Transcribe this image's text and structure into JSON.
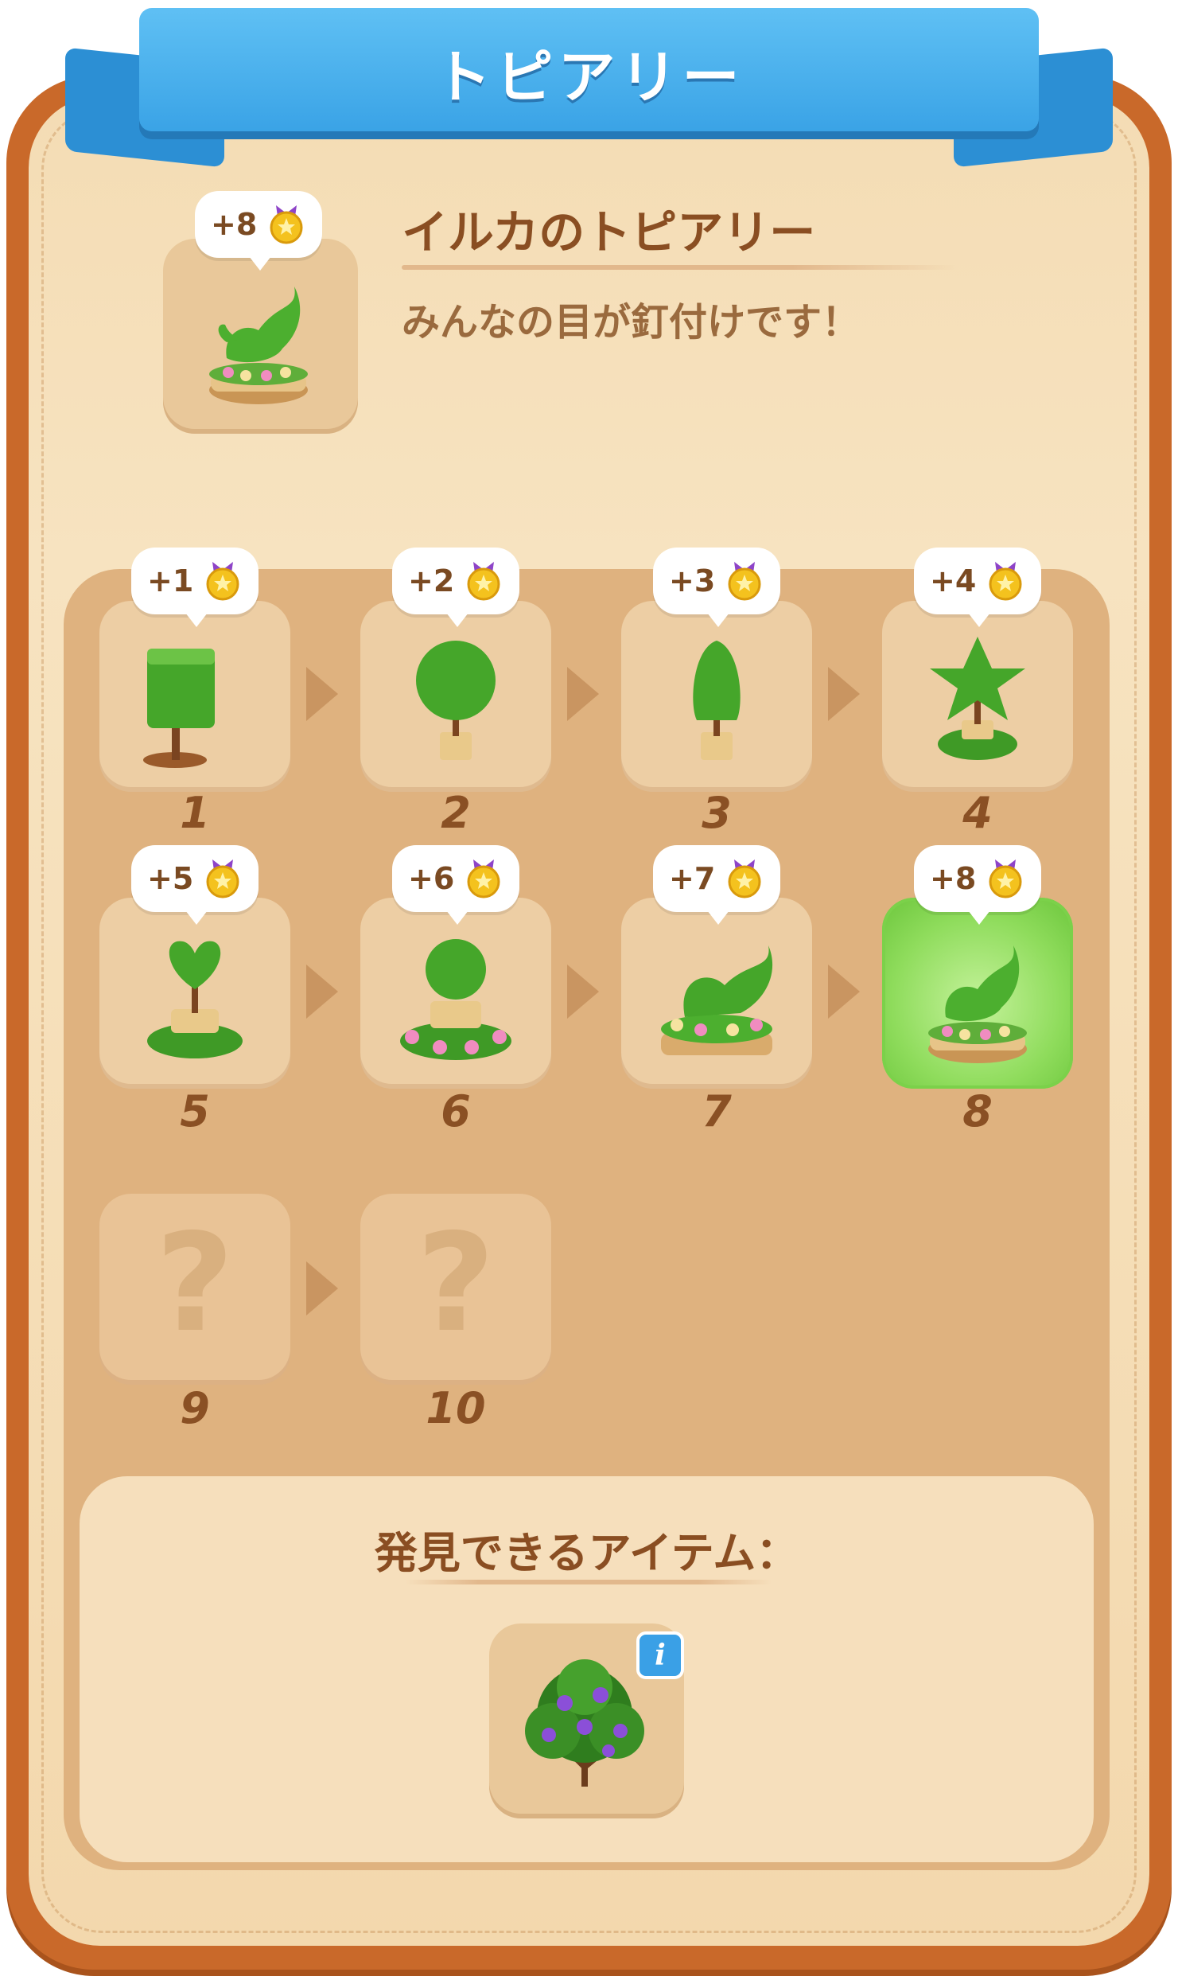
{
  "header": {
    "title": "トピアリー"
  },
  "featured": {
    "bonus": "+8",
    "name": "イルカのトピアリー",
    "description": "みんなの目が釘付けです！"
  },
  "stages": [
    {
      "number": "1",
      "bonus": "+1",
      "state": "unlocked"
    },
    {
      "number": "2",
      "bonus": "+2",
      "state": "unlocked"
    },
    {
      "number": "3",
      "bonus": "+3",
      "state": "unlocked"
    },
    {
      "number": "4",
      "bonus": "+4",
      "state": "unlocked"
    },
    {
      "number": "5",
      "bonus": "+5",
      "state": "unlocked"
    },
    {
      "number": "6",
      "bonus": "+6",
      "state": "unlocked"
    },
    {
      "number": "7",
      "bonus": "+7",
      "state": "unlocked"
    },
    {
      "number": "8",
      "bonus": "+8",
      "state": "current"
    },
    {
      "number": "9",
      "placeholder": "?",
      "state": "locked"
    },
    {
      "number": "10",
      "placeholder": "?",
      "state": "locked"
    }
  ],
  "discoverable": {
    "title": "発見できるアイテム：",
    "item_icon": "flowering-bush-icon",
    "info_icon": "info-icon"
  },
  "colors": {
    "banner": "#3aa3e6",
    "frame": "#c9692a",
    "active_cell": "#8fdc5c",
    "text_brown": "#8a4e22"
  }
}
